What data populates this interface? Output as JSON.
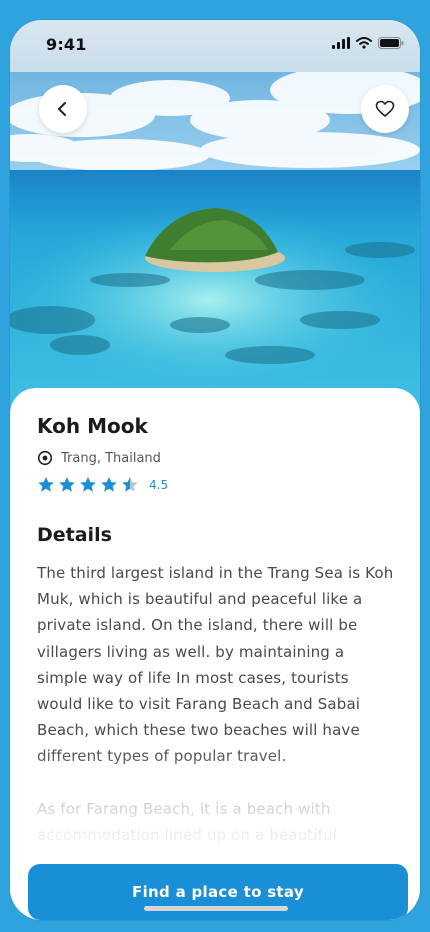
{
  "status_bar": {
    "time": "9:41",
    "icons": [
      "signal-icon",
      "wifi-icon",
      "battery-icon"
    ]
  },
  "hero": {
    "back_icon": "chevron-left-icon",
    "favorite_icon": "heart-icon"
  },
  "place": {
    "name": "Koh Mook",
    "location": "Trang, Thailand",
    "location_icon": "location-pin-icon",
    "rating": "4.5",
    "rating_value": 4.5,
    "rating_max": 5
  },
  "details": {
    "heading": "Details",
    "paragraphs": [
      "The third largest island in the Trang Sea is Koh Muk, which is beautiful and peaceful like a private island. On the island, there will be villagers living as well. by maintaining a simple way of life In most cases, tourists would like to visit Farang Beach and Sabai Beach, which these two beaches will have different types of popular travel.",
      "As for Farang Beach, it is a beach with accommodation lined up on a beautiful"
    ]
  },
  "cta": {
    "label": "Find a place to stay"
  },
  "colors": {
    "accent": "#1a8fd8",
    "star": "#1a8fd8",
    "background": "#2fa3dd"
  }
}
